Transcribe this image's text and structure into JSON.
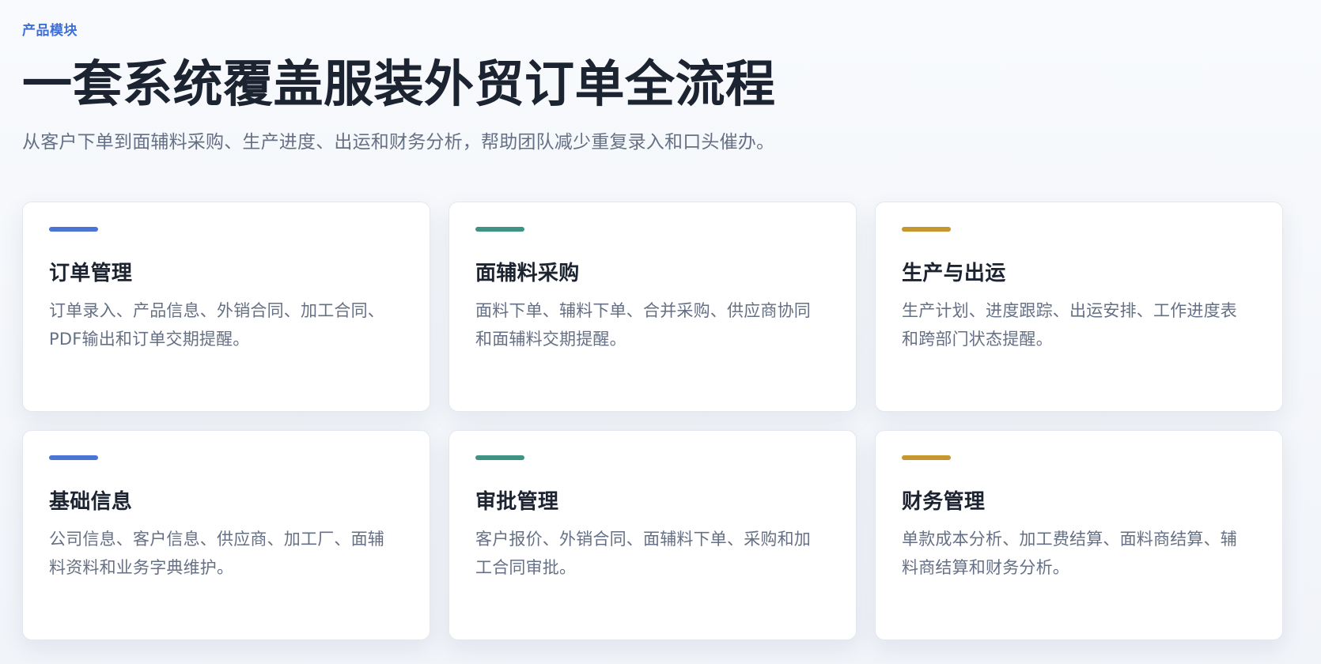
{
  "header": {
    "eyebrow": "产品模块",
    "title": "一套系统覆盖服装外贸订单全流程",
    "subtitle": "从客户下单到面辅料采购、生产进度、出运和财务分析，帮助团队减少重复录入和口头催办。"
  },
  "colors": {
    "blue": "#4b74d6",
    "teal": "#3f9386",
    "gold": "#c6962f",
    "eyebrow": "#3f6fd6"
  },
  "cards": [
    {
      "title": "订单管理",
      "description": "订单录入、产品信息、外销合同、加工合同、PDF输出和订单交期提醒。"
    },
    {
      "title": "面辅料采购",
      "description": "面料下单、辅料下单、合并采购、供应商协同和面辅料交期提醒。"
    },
    {
      "title": "生产与出运",
      "description": "生产计划、进度跟踪、出运安排、工作进度表和跨部门状态提醒。"
    },
    {
      "title": "基础信息",
      "description": "公司信息、客户信息、供应商、加工厂、面辅料资料和业务字典维护。"
    },
    {
      "title": "审批管理",
      "description": "客户报价、外销合同、面辅料下单、采购和加工合同审批。"
    },
    {
      "title": "财务管理",
      "description": "单款成本分析、加工费结算、面料商结算、辅料商结算和财务分析。"
    }
  ]
}
